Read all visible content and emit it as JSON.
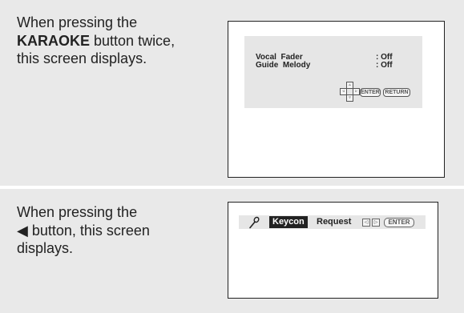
{
  "section1": {
    "instruction_line1": "When pressing the",
    "instruction_bold": "KARAOKE",
    "instruction_rest": " button twice,",
    "instruction_line3": "this screen displays.",
    "menu": {
      "rows": [
        {
          "label": "Vocal  Fader",
          "value": ": Off"
        },
        {
          "label": "Guide  Melody",
          "value": ": Off"
        }
      ],
      "enter_label": "ENTER",
      "return_label": "RETURN"
    }
  },
  "section2": {
    "instruction_line1": "When pressing the",
    "instruction_arrow": "◀",
    "instruction_line2_rest": " button, this screen",
    "instruction_line3": "displays.",
    "keycon": {
      "badge": "Keycon",
      "request": "Request",
      "left_arrow": "◁",
      "right_arrow": "▷",
      "enter_label": "ENTER"
    }
  }
}
